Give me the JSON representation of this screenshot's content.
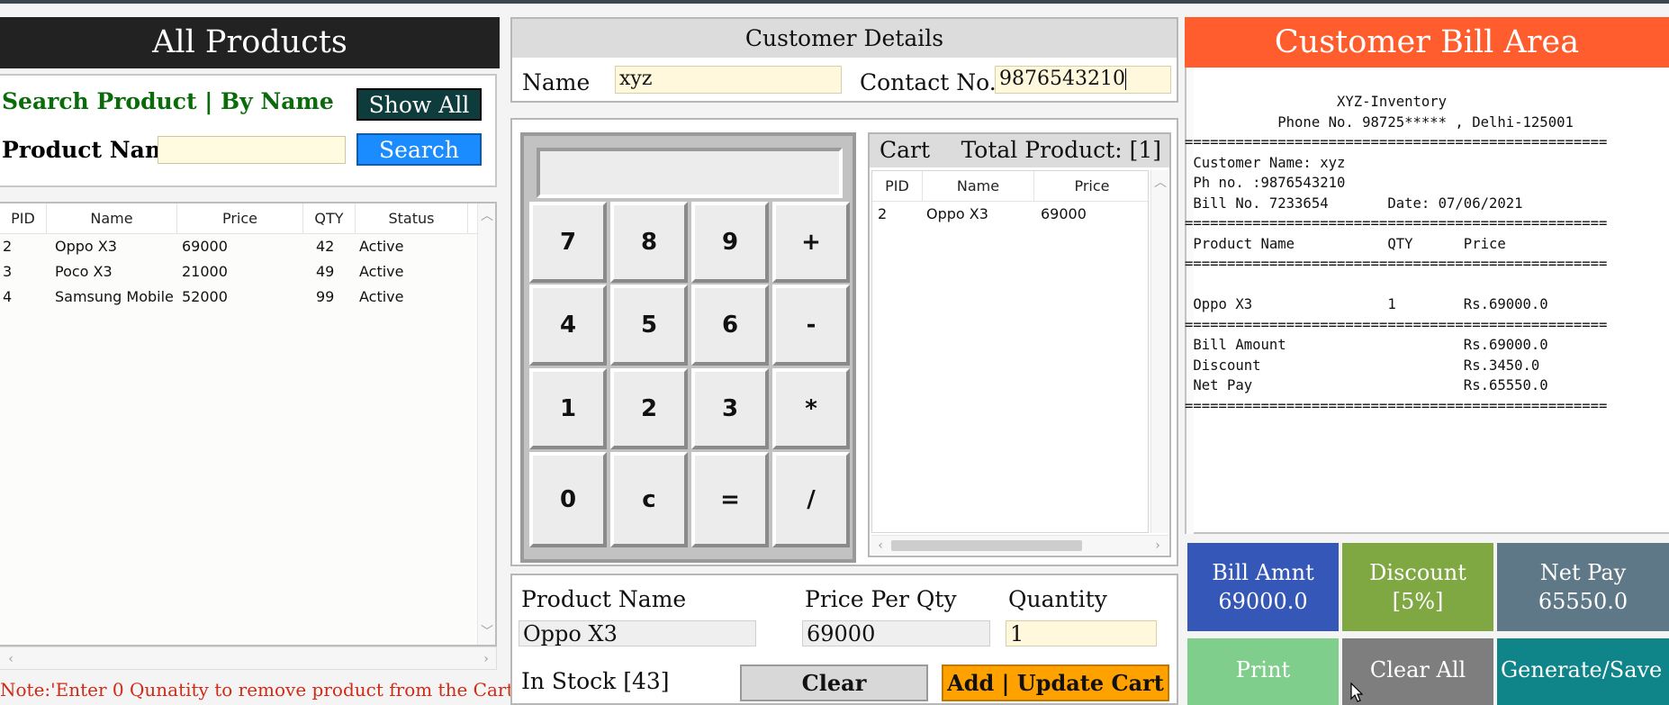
{
  "all_products": {
    "title": "All Products",
    "search_title": "Search Product | By Name",
    "show_all_label": "Show All",
    "product_name_label": "Product Name",
    "search_input_value": "",
    "search_label": "Search",
    "columns": [
      "PID",
      "Name",
      "Price",
      "QTY",
      "Status"
    ],
    "rows": [
      {
        "pid": "2",
        "name": "Oppo X3",
        "price": "69000",
        "qty": "42",
        "status": "Active"
      },
      {
        "pid": "3",
        "name": "Poco X3",
        "price": "21000",
        "qty": "49",
        "status": "Active"
      },
      {
        "pid": "4",
        "name": "Samsung Mobile",
        "price": "52000",
        "qty": "99",
        "status": "Active"
      }
    ],
    "note": "Note:'Enter  0 Qunatity to remove product from the Cart'"
  },
  "customer": {
    "title": "Customer Details",
    "name_label": "Name",
    "name_value": "xyz",
    "contact_label": "Contact No.",
    "contact_value": "9876543210"
  },
  "calculator": {
    "display": "",
    "keys": [
      [
        "7",
        "8",
        "9",
        "+"
      ],
      [
        "4",
        "5",
        "6",
        "-"
      ],
      [
        "1",
        "2",
        "3",
        "*"
      ],
      [
        "0",
        "c",
        "=",
        "/"
      ]
    ]
  },
  "cart": {
    "title": "Cart",
    "total_label": "Total Product: [1]",
    "columns": [
      "PID",
      "Name",
      "Price"
    ],
    "rows": [
      {
        "pid": "2",
        "name": "Oppo X3",
        "price": "69000"
      }
    ]
  },
  "product_form": {
    "name_label": "Product Name",
    "name_value": "Oppo X3",
    "price_label": "Price Per Qty",
    "price_value": "69000",
    "qty_label": "Quantity",
    "qty_value": "1",
    "stock_label": "In Stock [43]",
    "clear_label": "Clear",
    "add_label": "Add | Update Cart"
  },
  "bill": {
    "title": "Customer Bill Area",
    "text": "                  XYZ-Inventory\n           Phone No. 98725***** , Delhi-125001\n==================================================\n Customer Name: xyz\n Ph no. :9876543210\n Bill No. 7233654       Date: 07/06/2021\n==================================================\n Product Name           QTY      Price\n==================================================\n\n Oppo X3                1        Rs.69000.0\n==================================================\n Bill Amount                     Rs.69000.0\n Discount                        Rs.3450.0\n Net Pay                         Rs.65550.0\n=================================================="
  },
  "summary": {
    "bill_amnt_label": "Bill Amnt",
    "bill_amnt_value": "69000.0",
    "discount_label": "Discount",
    "discount_value": "[5%]",
    "net_pay_label": "Net Pay",
    "net_pay_value": "65550.0",
    "print_label": "Print",
    "clear_all_label": "Clear All",
    "generate_label": "Generate/Save Bill"
  },
  "colors": {
    "bill_header": "#ff5d2d",
    "bill_amnt": "#3457b8",
    "discount": "#7fa843",
    "net_pay": "#5f7887",
    "print": "#7fce8b",
    "clear_all": "#7e7e7e",
    "generate": "#0f8489",
    "add_cart": "#ffa200",
    "search": "#1a8cff"
  }
}
